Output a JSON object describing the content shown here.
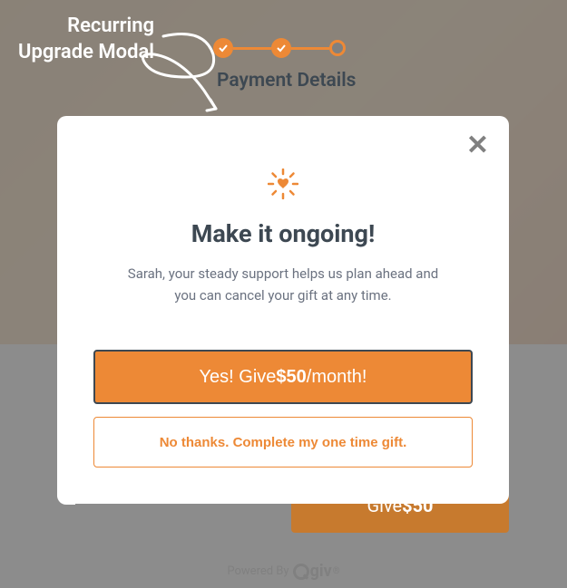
{
  "overlay": {
    "label_line1": "Recurring",
    "label_line2": "Upgrade Modal"
  },
  "stepper": {
    "title": "Payment Details"
  },
  "modal": {
    "title": "Make it ongoing!",
    "subtitle": "Sarah, your steady support helps us plan ahead and you can cancel your gift at any time.",
    "primary_prefix": "Yes! Give ",
    "primary_amount": "$50",
    "primary_suffix": "/month!",
    "secondary": "No thanks. Complete my one time gift."
  },
  "background": {
    "give_prefix": "Give ",
    "give_amount": "$50"
  },
  "footer": {
    "powered_by": "Powered By",
    "brand": "giv",
    "reg": "®"
  },
  "colors": {
    "accent": "#ed8936",
    "dark": "#3d4852",
    "gray": "#808080"
  }
}
